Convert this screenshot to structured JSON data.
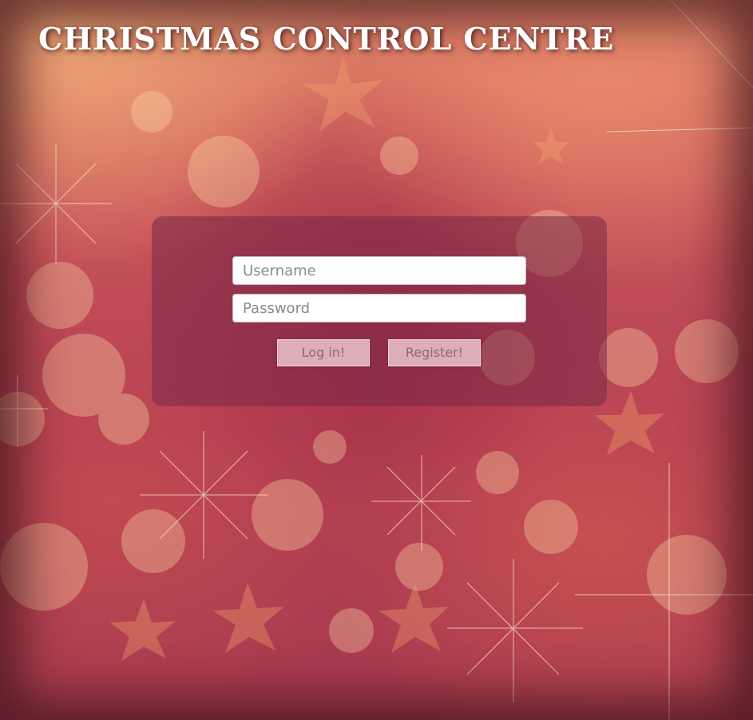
{
  "header": {
    "title": "CHRISTMAS CONTROL CENTRE"
  },
  "login_form": {
    "username_placeholder": "Username",
    "password_placeholder": "Password",
    "login_label": "Log in!",
    "register_label": "Register!"
  },
  "colors": {
    "panel_background": "#782846",
    "button_background": "#f0cdd7",
    "button_text": "#8b6a78"
  }
}
